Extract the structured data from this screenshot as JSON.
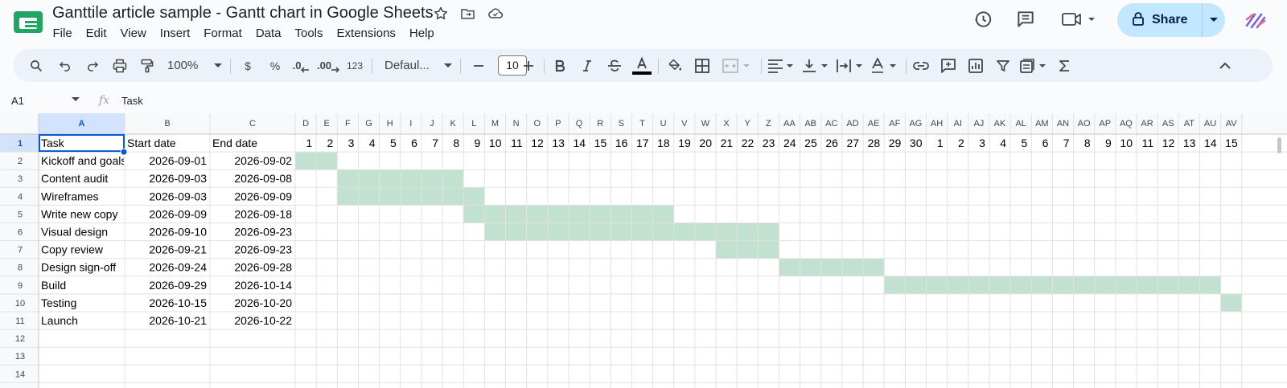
{
  "document": {
    "title": "Ganttile article sample - Gantt chart in Google Sheets"
  },
  "menu": [
    "File",
    "Edit",
    "View",
    "Insert",
    "Format",
    "Data",
    "Tools",
    "Extensions",
    "Help"
  ],
  "share": {
    "label": "Share"
  },
  "toolbar": {
    "zoom": "100%",
    "currency": "$",
    "percent": "%",
    "decrease_decimal": ".0",
    "increase_decimal": ".00",
    "number_format": "123",
    "font": "Defaul...",
    "font_size": "10"
  },
  "formula_bar": {
    "cell_ref": "A1",
    "fx": "fx",
    "value": "Task"
  },
  "sheet": {
    "column_letters": [
      "A",
      "B",
      "C",
      "D",
      "E",
      "F",
      "G",
      "H",
      "I",
      "J",
      "K",
      "L",
      "M",
      "N",
      "O",
      "P",
      "Q",
      "R",
      "S",
      "T",
      "U",
      "V",
      "W",
      "X",
      "Y",
      "Z",
      "AA",
      "AB",
      "AC",
      "AD",
      "AE",
      "AF",
      "AG",
      "AH",
      "AI",
      "AJ",
      "AK",
      "AL",
      "AM",
      "AN",
      "AO",
      "AP",
      "AQ",
      "AR",
      "AS",
      "AT",
      "AU",
      "AV"
    ],
    "row_numbers": [
      "1",
      "2",
      "3",
      "4",
      "5",
      "6",
      "7",
      "8",
      "9",
      "10",
      "11",
      "12",
      "13",
      "14"
    ],
    "headers": [
      "Task",
      "Start date",
      "End date"
    ],
    "day_labels": [
      "1",
      "2",
      "3",
      "4",
      "5",
      "6",
      "7",
      "8",
      "9",
      "10",
      "11",
      "12",
      "13",
      "14",
      "15",
      "16",
      "17",
      "18",
      "19",
      "20",
      "21",
      "22",
      "23",
      "24",
      "25",
      "26",
      "27",
      "28",
      "29",
      "30",
      "1",
      "2",
      "3",
      "4",
      "5",
      "6",
      "7",
      "8",
      "9",
      "10",
      "11",
      "12",
      "13",
      "14",
      "15"
    ],
    "tasks": [
      {
        "name": "Kickoff and goals",
        "start": "2026-09-01",
        "end": "2026-09-02"
      },
      {
        "name": "Content audit",
        "start": "2026-09-03",
        "end": "2026-09-08"
      },
      {
        "name": "Wireframes",
        "start": "2026-09-03",
        "end": "2026-09-09"
      },
      {
        "name": "Write new copy",
        "start": "2026-09-09",
        "end": "2026-09-18"
      },
      {
        "name": "Visual design",
        "start": "2026-09-10",
        "end": "2026-09-23"
      },
      {
        "name": "Copy review",
        "start": "2026-09-21",
        "end": "2026-09-23"
      },
      {
        "name": "Design sign-off",
        "start": "2026-09-24",
        "end": "2026-09-28"
      },
      {
        "name": "Build",
        "start": "2026-09-29",
        "end": "2026-10-14"
      },
      {
        "name": "Testing",
        "start": "2026-10-15",
        "end": "2026-10-20"
      },
      {
        "name": "Launch",
        "start": "2026-10-21",
        "end": "2026-10-22"
      }
    ],
    "bar_color": "#c2e1d1",
    "selection_color": "#0b57d0",
    "header_selected_bg": "#d3e3fd"
  },
  "icons": [
    "star-icon",
    "move-folder-icon",
    "cloud-saved-icon",
    "history-icon",
    "comments-icon",
    "meet-icon",
    "lock-icon",
    "search-icon",
    "undo-icon",
    "redo-icon",
    "print-icon",
    "paint-format-icon",
    "bold-icon",
    "italic-icon",
    "strikethrough-icon",
    "text-color-icon",
    "fill-color-icon",
    "borders-icon",
    "merge-icon",
    "align-icon",
    "valign-icon",
    "wrap-icon",
    "rotate-icon",
    "link-icon",
    "comment-icon",
    "chart-icon",
    "filter-icon",
    "filter-views-icon",
    "functions-icon",
    "collapse-icon"
  ]
}
